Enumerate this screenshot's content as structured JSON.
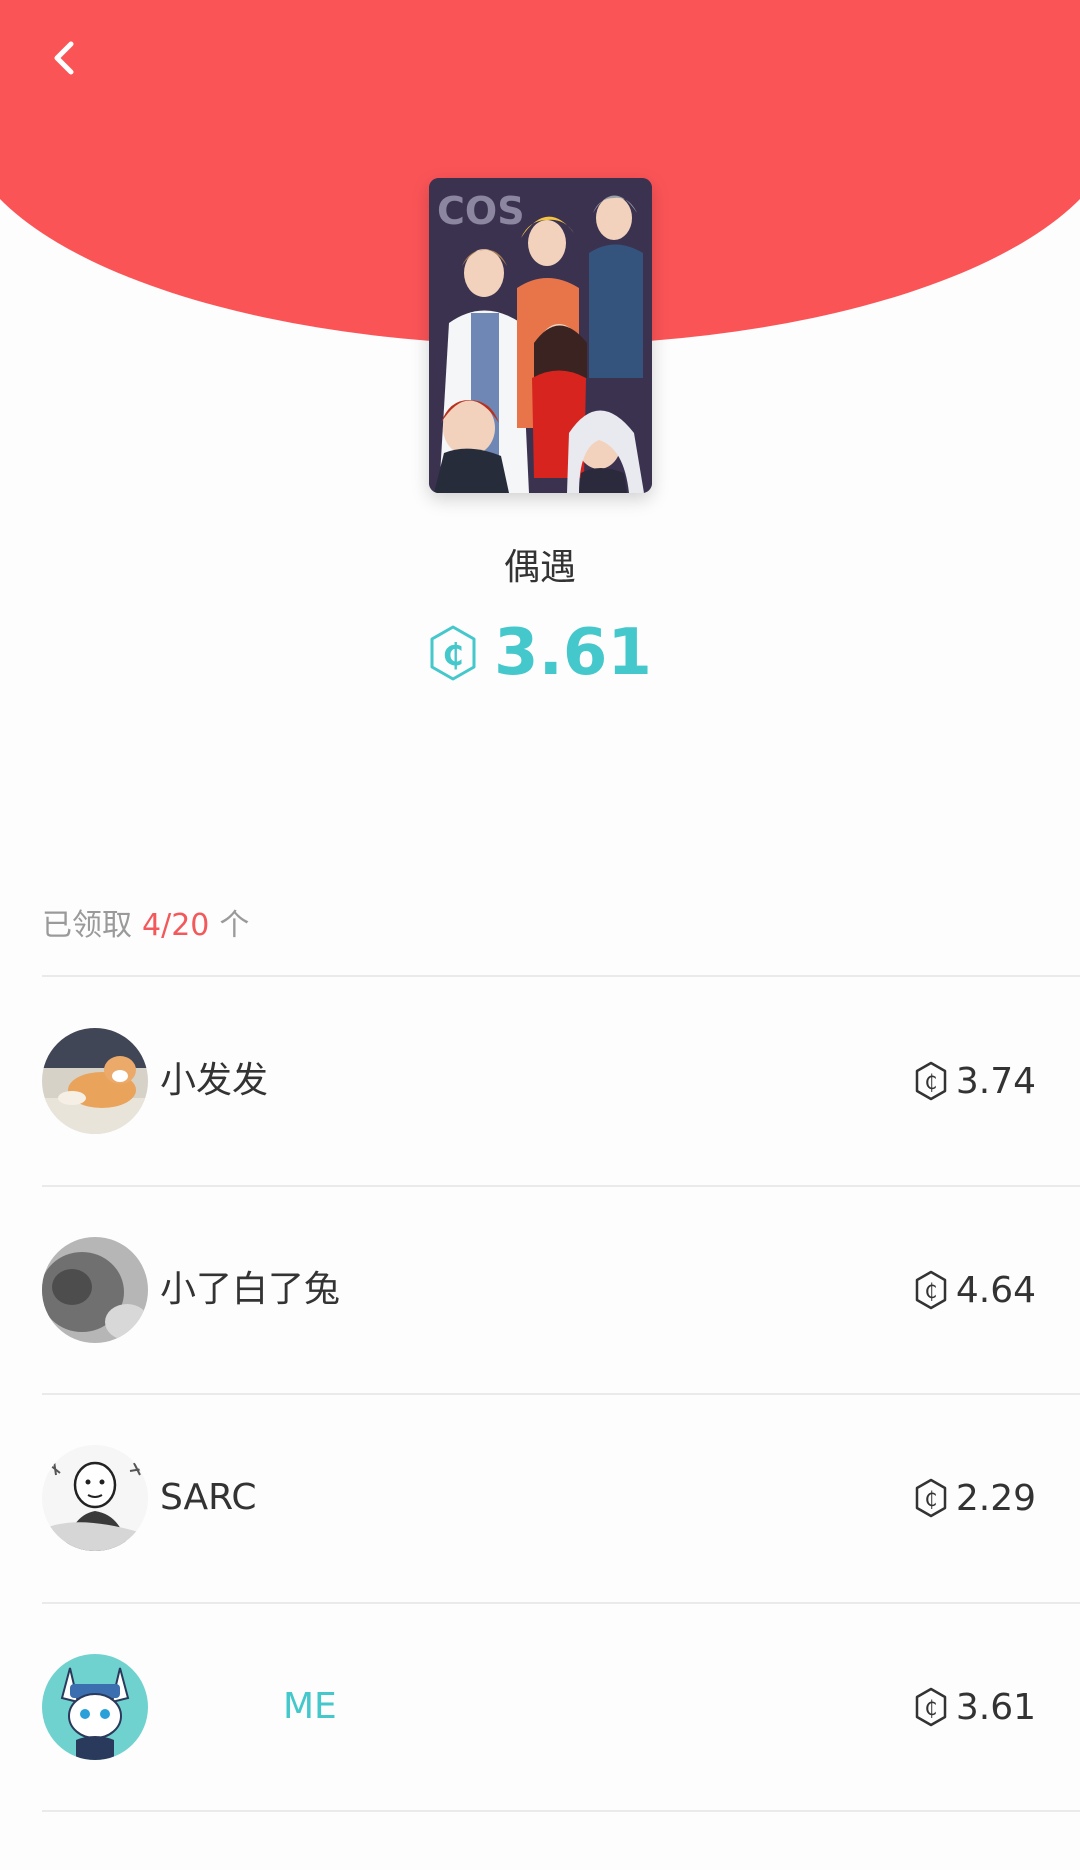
{
  "header": {
    "back_icon": "chevron-left-icon"
  },
  "colors": {
    "accent_red": "#fb5457",
    "accent_teal": "#44c8cc"
  },
  "item": {
    "title": "偶遇",
    "amount": "3.61",
    "cover_text": "COS",
    "coin_icon": "coin-icon"
  },
  "claim_status": {
    "prefix": "已领取",
    "count": "4/20",
    "suffix": "个"
  },
  "recipients": [
    {
      "name": "小发发",
      "amount": "3.74"
    },
    {
      "name": "小了白了兔",
      "amount": "4.64"
    },
    {
      "name": "SARC",
      "amount": "2.29"
    },
    {
      "name": "ME",
      "amount": "3.61"
    }
  ]
}
